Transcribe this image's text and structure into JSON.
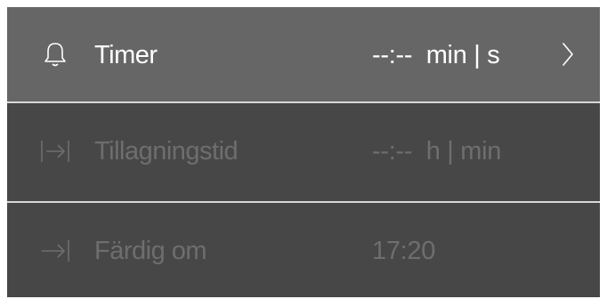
{
  "rows": [
    {
      "icon": "bell-icon",
      "label": "Timer",
      "value": "--:--  min | s",
      "has_chevron": true,
      "enabled": true
    },
    {
      "icon": "duration-arrow-icon",
      "label": "Tillagningstid",
      "value": "--:--  h | min",
      "has_chevron": false,
      "enabled": false
    },
    {
      "icon": "end-arrow-icon",
      "label": "Färdig om",
      "value": "17:20",
      "has_chevron": false,
      "enabled": false
    }
  ],
  "colors": {
    "active_row_bg": "#666666",
    "inactive_row_bg": "#474747",
    "active_text": "#ffffff",
    "inactive_text": "#6e6e6e",
    "divider": "#d8d8d8"
  }
}
